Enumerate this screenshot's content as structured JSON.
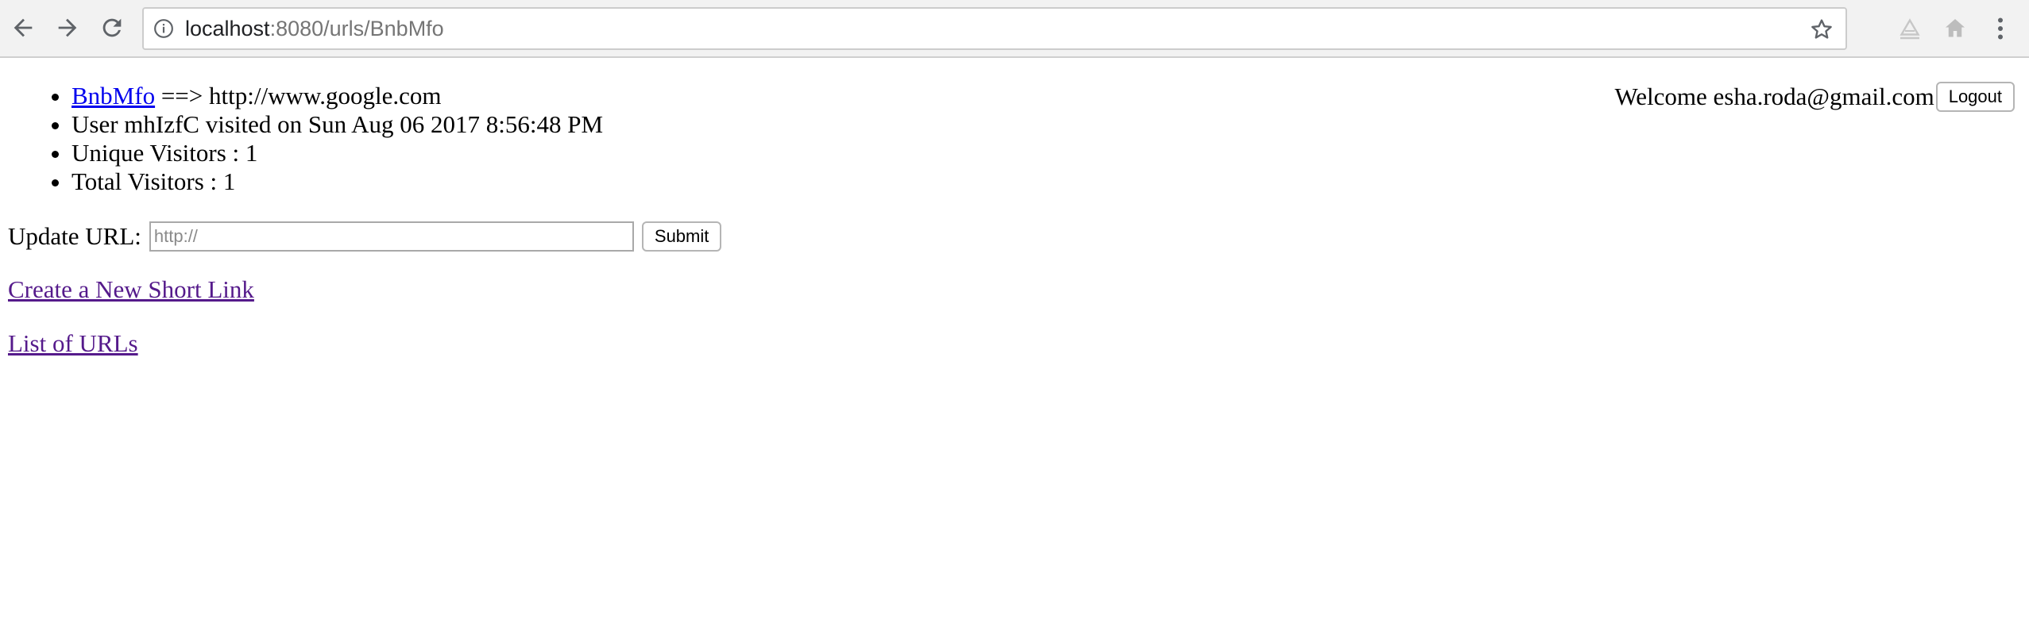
{
  "browser": {
    "url_host": "localhost",
    "url_path": ":8080/urls/BnbMfo"
  },
  "page": {
    "short_code": "BnbMfo",
    "arrow_target": " ==> http://www.google.com",
    "visit_line": "User mhIzfC visited on Sun Aug 06 2017 8:56:48 PM",
    "unique_visitors": "Unique Visitors : 1",
    "total_visitors": "Total Visitors : 1",
    "welcome_text": "Welcome esha.roda@gmail.com",
    "logout_label": "Logout",
    "update_label": "Update URL:",
    "update_placeholder": "http://",
    "submit_label": "Submit",
    "create_link": "Create a New Short Link",
    "list_link": "List of URLs"
  },
  "colors": {
    "link": "#0000ee",
    "visited_link": "#551a8b",
    "toolbar_bg": "#f2f2f2"
  },
  "icons": {
    "back": "back-arrow-icon",
    "forward": "forward-arrow-icon",
    "reload": "reload-icon",
    "info": "info-icon",
    "bookmark": "star-icon",
    "extension": "extension-icon",
    "home": "home-icon",
    "menu": "menu-icon"
  }
}
